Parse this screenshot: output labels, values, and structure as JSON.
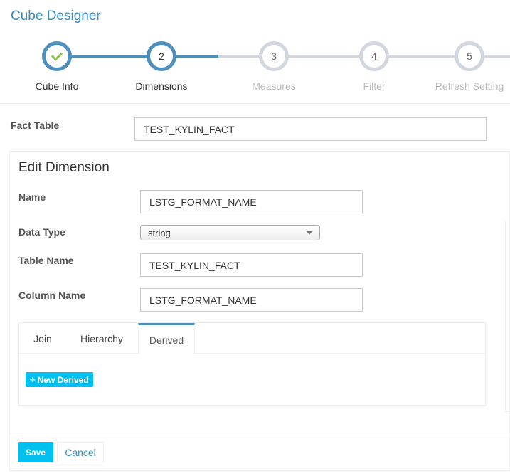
{
  "header": {
    "title": "Cube Designer"
  },
  "wizard": {
    "steps": [
      {
        "number": "",
        "label": "Cube Info",
        "state": "done"
      },
      {
        "number": "2",
        "label": "Dimensions",
        "state": "active"
      },
      {
        "number": "3",
        "label": "Measures",
        "state": "pending"
      },
      {
        "number": "4",
        "label": "Filter",
        "state": "pending"
      },
      {
        "number": "5",
        "label": "Refresh Setting",
        "state": "pending"
      }
    ]
  },
  "fact_table": {
    "label": "Fact Table",
    "value": "TEST_KYLIN_FACT"
  },
  "edit_dimension": {
    "title": "Edit Dimension",
    "name_label": "Name",
    "name_value": "LSTG_FORMAT_NAME",
    "data_type_label": "Data Type",
    "data_type_value": "string",
    "table_name_label": "Table Name",
    "table_name_value": "TEST_KYLIN_FACT",
    "column_name_label": "Column Name",
    "column_name_value": "LSTG_FORMAT_NAME",
    "tabs": [
      {
        "label": "Join",
        "active": false
      },
      {
        "label": "Hierarchy",
        "active": false
      },
      {
        "label": "Derived",
        "active": true
      }
    ],
    "new_derived_label": "New Derived",
    "save_label": "Save",
    "cancel_label": "Cancel"
  },
  "colors": {
    "accent": "#4e8fbd",
    "button": "#00c0ef",
    "link": "#3c8dbc",
    "check": "#8bc34a"
  }
}
